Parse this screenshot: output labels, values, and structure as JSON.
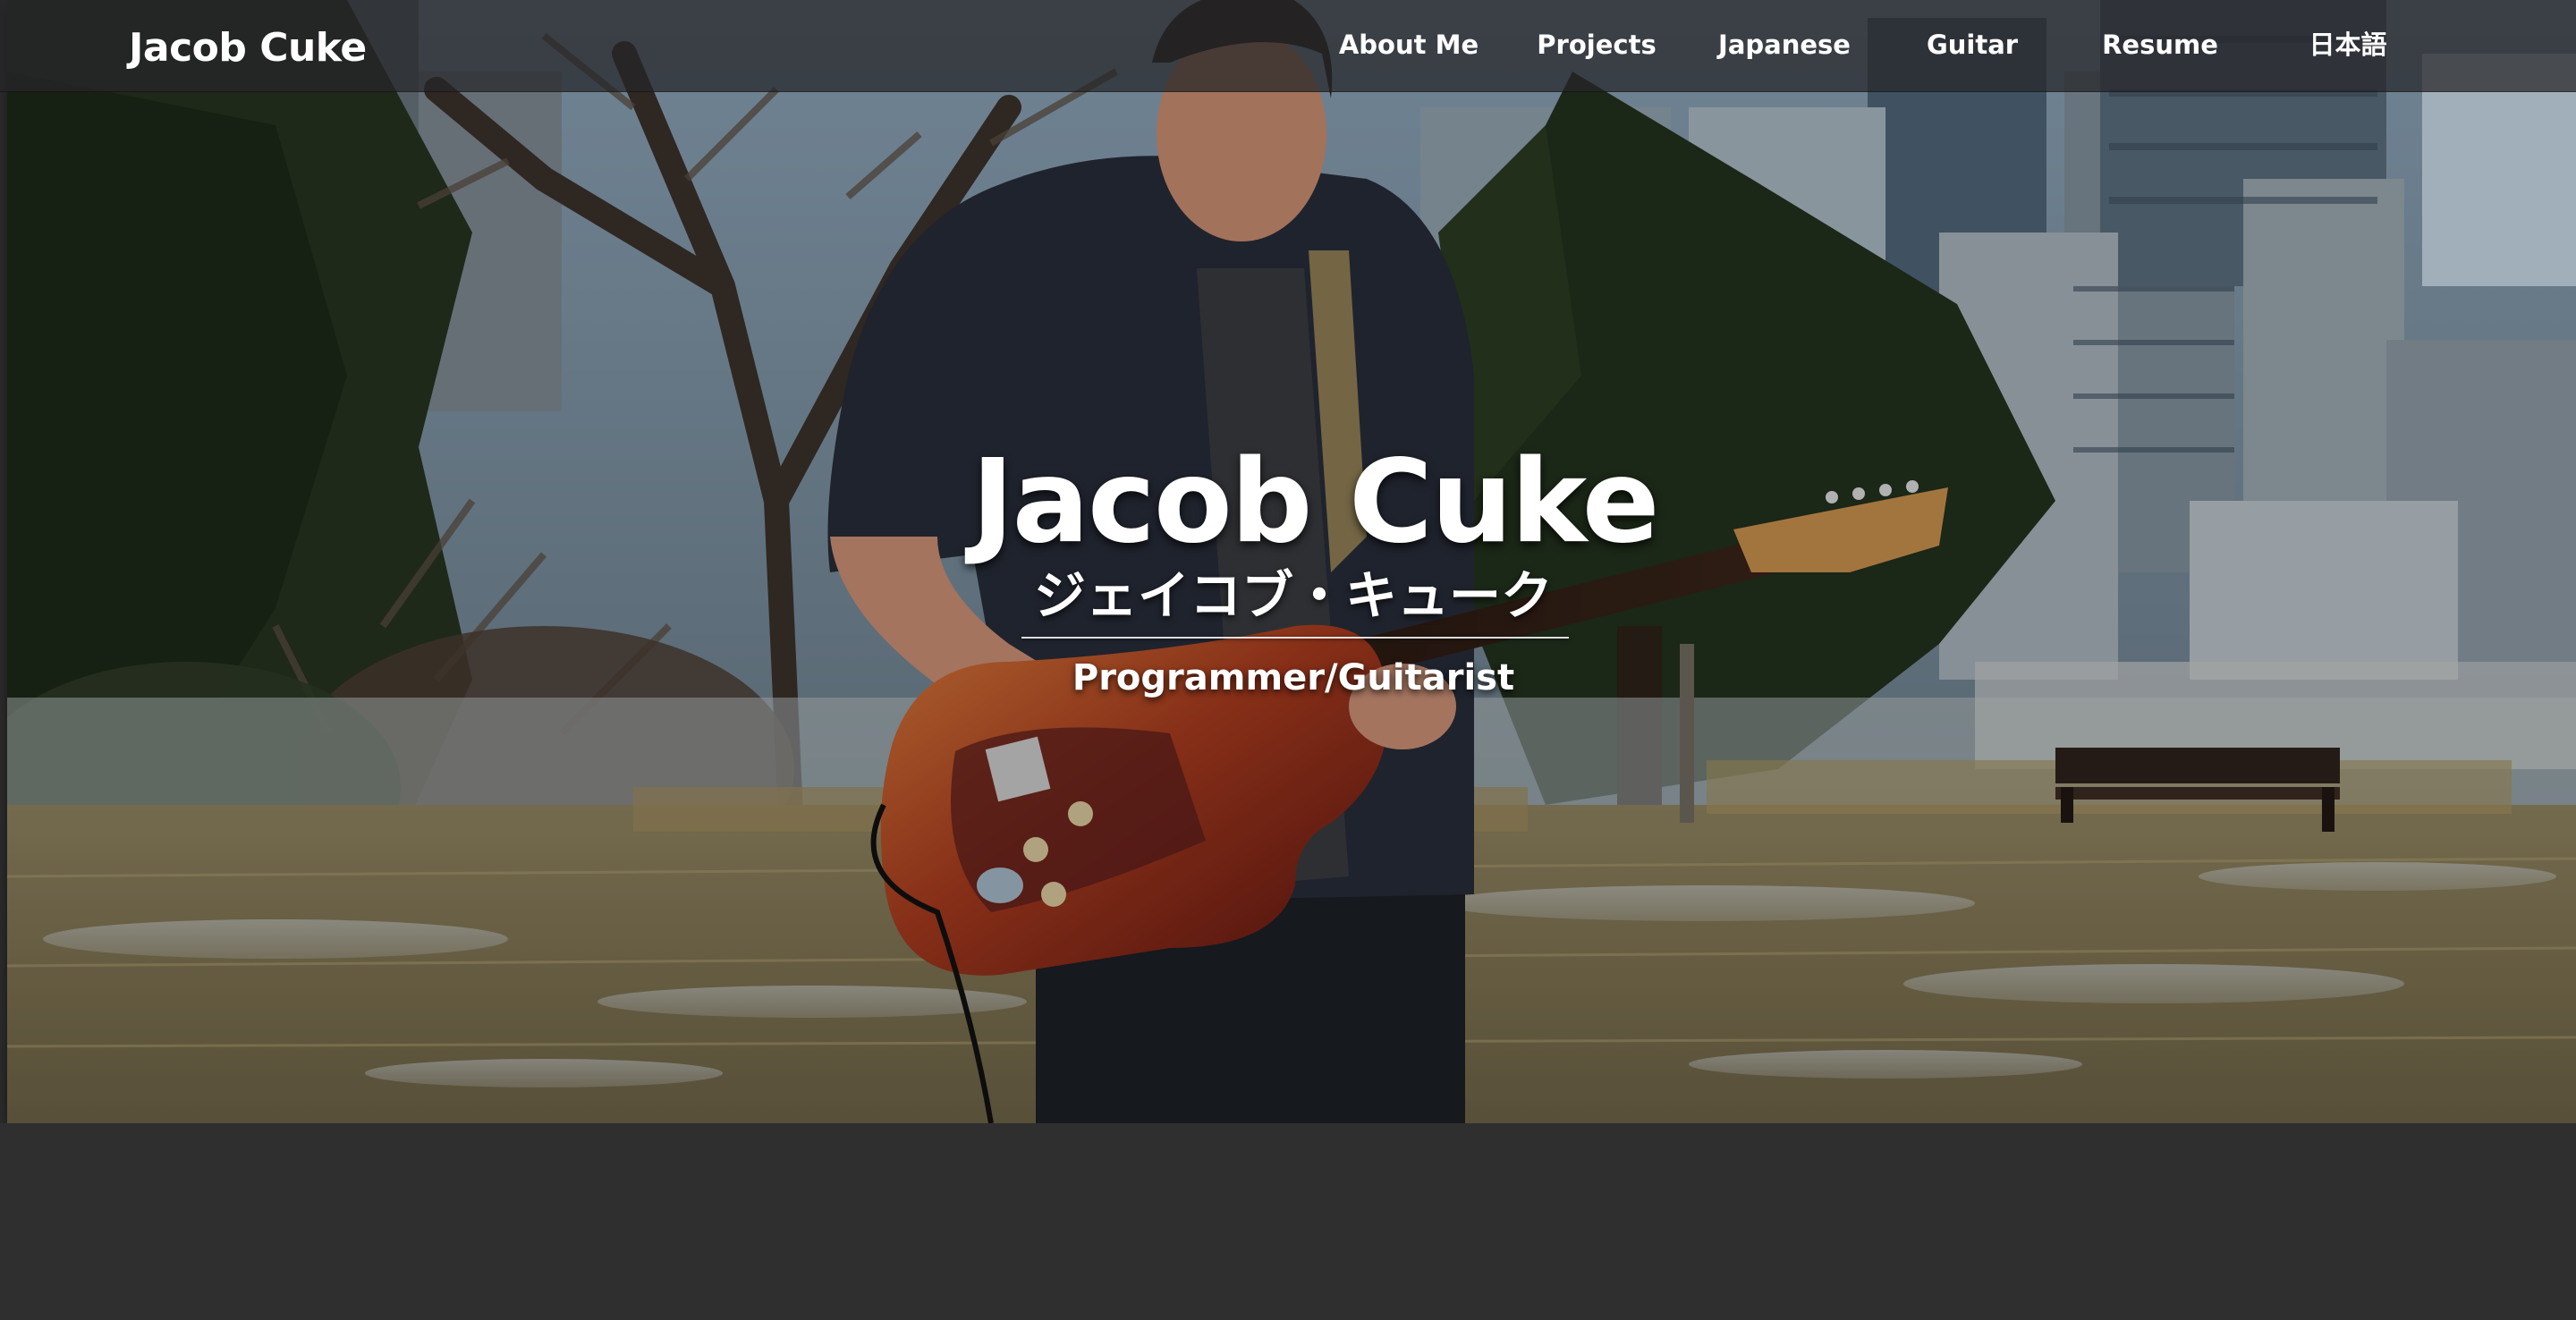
{
  "navbar": {
    "brand": "Jacob Cuke",
    "links": [
      {
        "label": "About Me"
      },
      {
        "label": "Projects"
      },
      {
        "label": "Japanese"
      },
      {
        "label": "Guitar"
      },
      {
        "label": "Resume"
      },
      {
        "label": "日本語"
      }
    ]
  },
  "hero": {
    "name": "Jacob Cuke",
    "name_japanese": "ジェイコブ・キューク",
    "role": "Programmer/Guitarist",
    "photo_icon": "guitarist-in-park-photo"
  },
  "colors": {
    "page_background": "#2f2f2f",
    "navbar_background": "#262628",
    "text": "#ffffff"
  }
}
